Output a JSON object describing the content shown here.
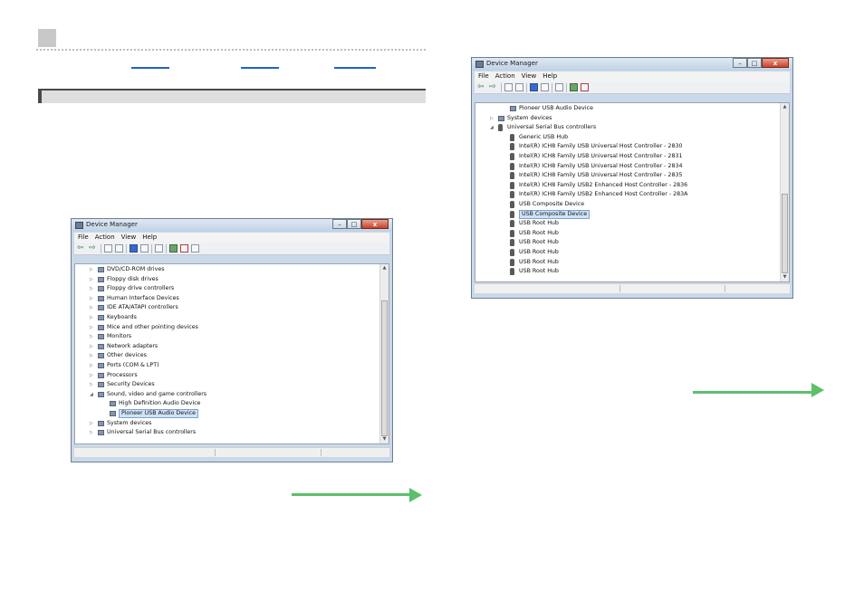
{
  "window_left": {
    "title": "Device Manager",
    "controls": {
      "minimize": "–",
      "maximize": "□",
      "close": "x"
    },
    "menu": [
      "File",
      "Action",
      "View",
      "Help"
    ],
    "tree": [
      {
        "indent": 0,
        "expander": "▷",
        "label": "DVD/CD-ROM drives"
      },
      {
        "indent": 0,
        "expander": "▷",
        "label": "Floppy disk drives"
      },
      {
        "indent": 0,
        "expander": "▷",
        "label": "Floppy drive controllers"
      },
      {
        "indent": 0,
        "expander": "▷",
        "label": "Human Interface Devices"
      },
      {
        "indent": 0,
        "expander": "▷",
        "label": "IDE ATA/ATAPI controllers"
      },
      {
        "indent": 0,
        "expander": "▷",
        "label": "Keyboards"
      },
      {
        "indent": 0,
        "expander": "▷",
        "label": "Mice and other pointing devices"
      },
      {
        "indent": 0,
        "expander": "▷",
        "label": "Monitors"
      },
      {
        "indent": 0,
        "expander": "▷",
        "label": "Network adapters"
      },
      {
        "indent": 0,
        "expander": "▷",
        "label": "Other devices"
      },
      {
        "indent": 0,
        "expander": "▷",
        "label": "Ports (COM & LPT)"
      },
      {
        "indent": 0,
        "expander": "▷",
        "label": "Processors"
      },
      {
        "indent": 0,
        "expander": "▷",
        "label": "Security Devices"
      },
      {
        "indent": 0,
        "expander": "◢",
        "label": "Sound, video and game controllers"
      },
      {
        "indent": 1,
        "expander": "",
        "label": "High Definition Audio Device"
      },
      {
        "indent": 1,
        "expander": "",
        "label": "Pioneer USB Audio Device",
        "selected": true
      },
      {
        "indent": 0,
        "expander": "▷",
        "label": "System devices"
      },
      {
        "indent": 0,
        "expander": "▷",
        "label": "Universal Serial Bus controllers"
      }
    ],
    "scroll_fraction": 0.55
  },
  "window_right": {
    "title": "Device Manager",
    "controls": {
      "minimize": "–",
      "maximize": "□",
      "close": "x"
    },
    "menu": [
      "File",
      "Action",
      "View",
      "Help"
    ],
    "tree": [
      {
        "indent": 1,
        "expander": "",
        "label": "Pioneer USB Audio Device",
        "usb": false
      },
      {
        "indent": 0,
        "expander": "▷",
        "label": "System devices",
        "usb": false
      },
      {
        "indent": 0,
        "expander": "◢",
        "label": "Universal Serial Bus controllers",
        "usb": true
      },
      {
        "indent": 1,
        "expander": "",
        "label": "Generic USB Hub",
        "usb": true
      },
      {
        "indent": 1,
        "expander": "",
        "label": "Intel(R) ICH8 Family USB Universal Host Controller - 2830",
        "usb": true
      },
      {
        "indent": 1,
        "expander": "",
        "label": "Intel(R) ICH8 Family USB Universal Host Controller - 2831",
        "usb": true
      },
      {
        "indent": 1,
        "expander": "",
        "label": "Intel(R) ICH8 Family USB Universal Host Controller - 2834",
        "usb": true
      },
      {
        "indent": 1,
        "expander": "",
        "label": "Intel(R) ICH8 Family USB Universal Host Controller - 2835",
        "usb": true
      },
      {
        "indent": 1,
        "expander": "",
        "label": "Intel(R) ICH8 Family USB2 Enhanced Host Controller - 2836",
        "usb": true
      },
      {
        "indent": 1,
        "expander": "",
        "label": "Intel(R) ICH8 Family USB2 Enhanced Host Controller - 283A",
        "usb": true
      },
      {
        "indent": 1,
        "expander": "",
        "label": "USB Composite Device",
        "usb": true
      },
      {
        "indent": 1,
        "expander": "",
        "label": "USB Composite Device",
        "usb": true,
        "selected": true
      },
      {
        "indent": 1,
        "expander": "",
        "label": "USB Root Hub",
        "usb": true
      },
      {
        "indent": 1,
        "expander": "",
        "label": "USB Root Hub",
        "usb": true
      },
      {
        "indent": 1,
        "expander": "",
        "label": "USB Root Hub",
        "usb": true
      },
      {
        "indent": 1,
        "expander": "",
        "label": "USB Root Hub",
        "usb": true
      },
      {
        "indent": 1,
        "expander": "",
        "label": "USB Root Hub",
        "usb": true
      },
      {
        "indent": 1,
        "expander": "",
        "label": "USB Root Hub",
        "usb": true
      }
    ],
    "scroll_fraction": 0.85
  },
  "colors": {
    "accent_green": "#5cc06b",
    "link_blue": "#1e64c8",
    "section_bar": "#dedede"
  }
}
